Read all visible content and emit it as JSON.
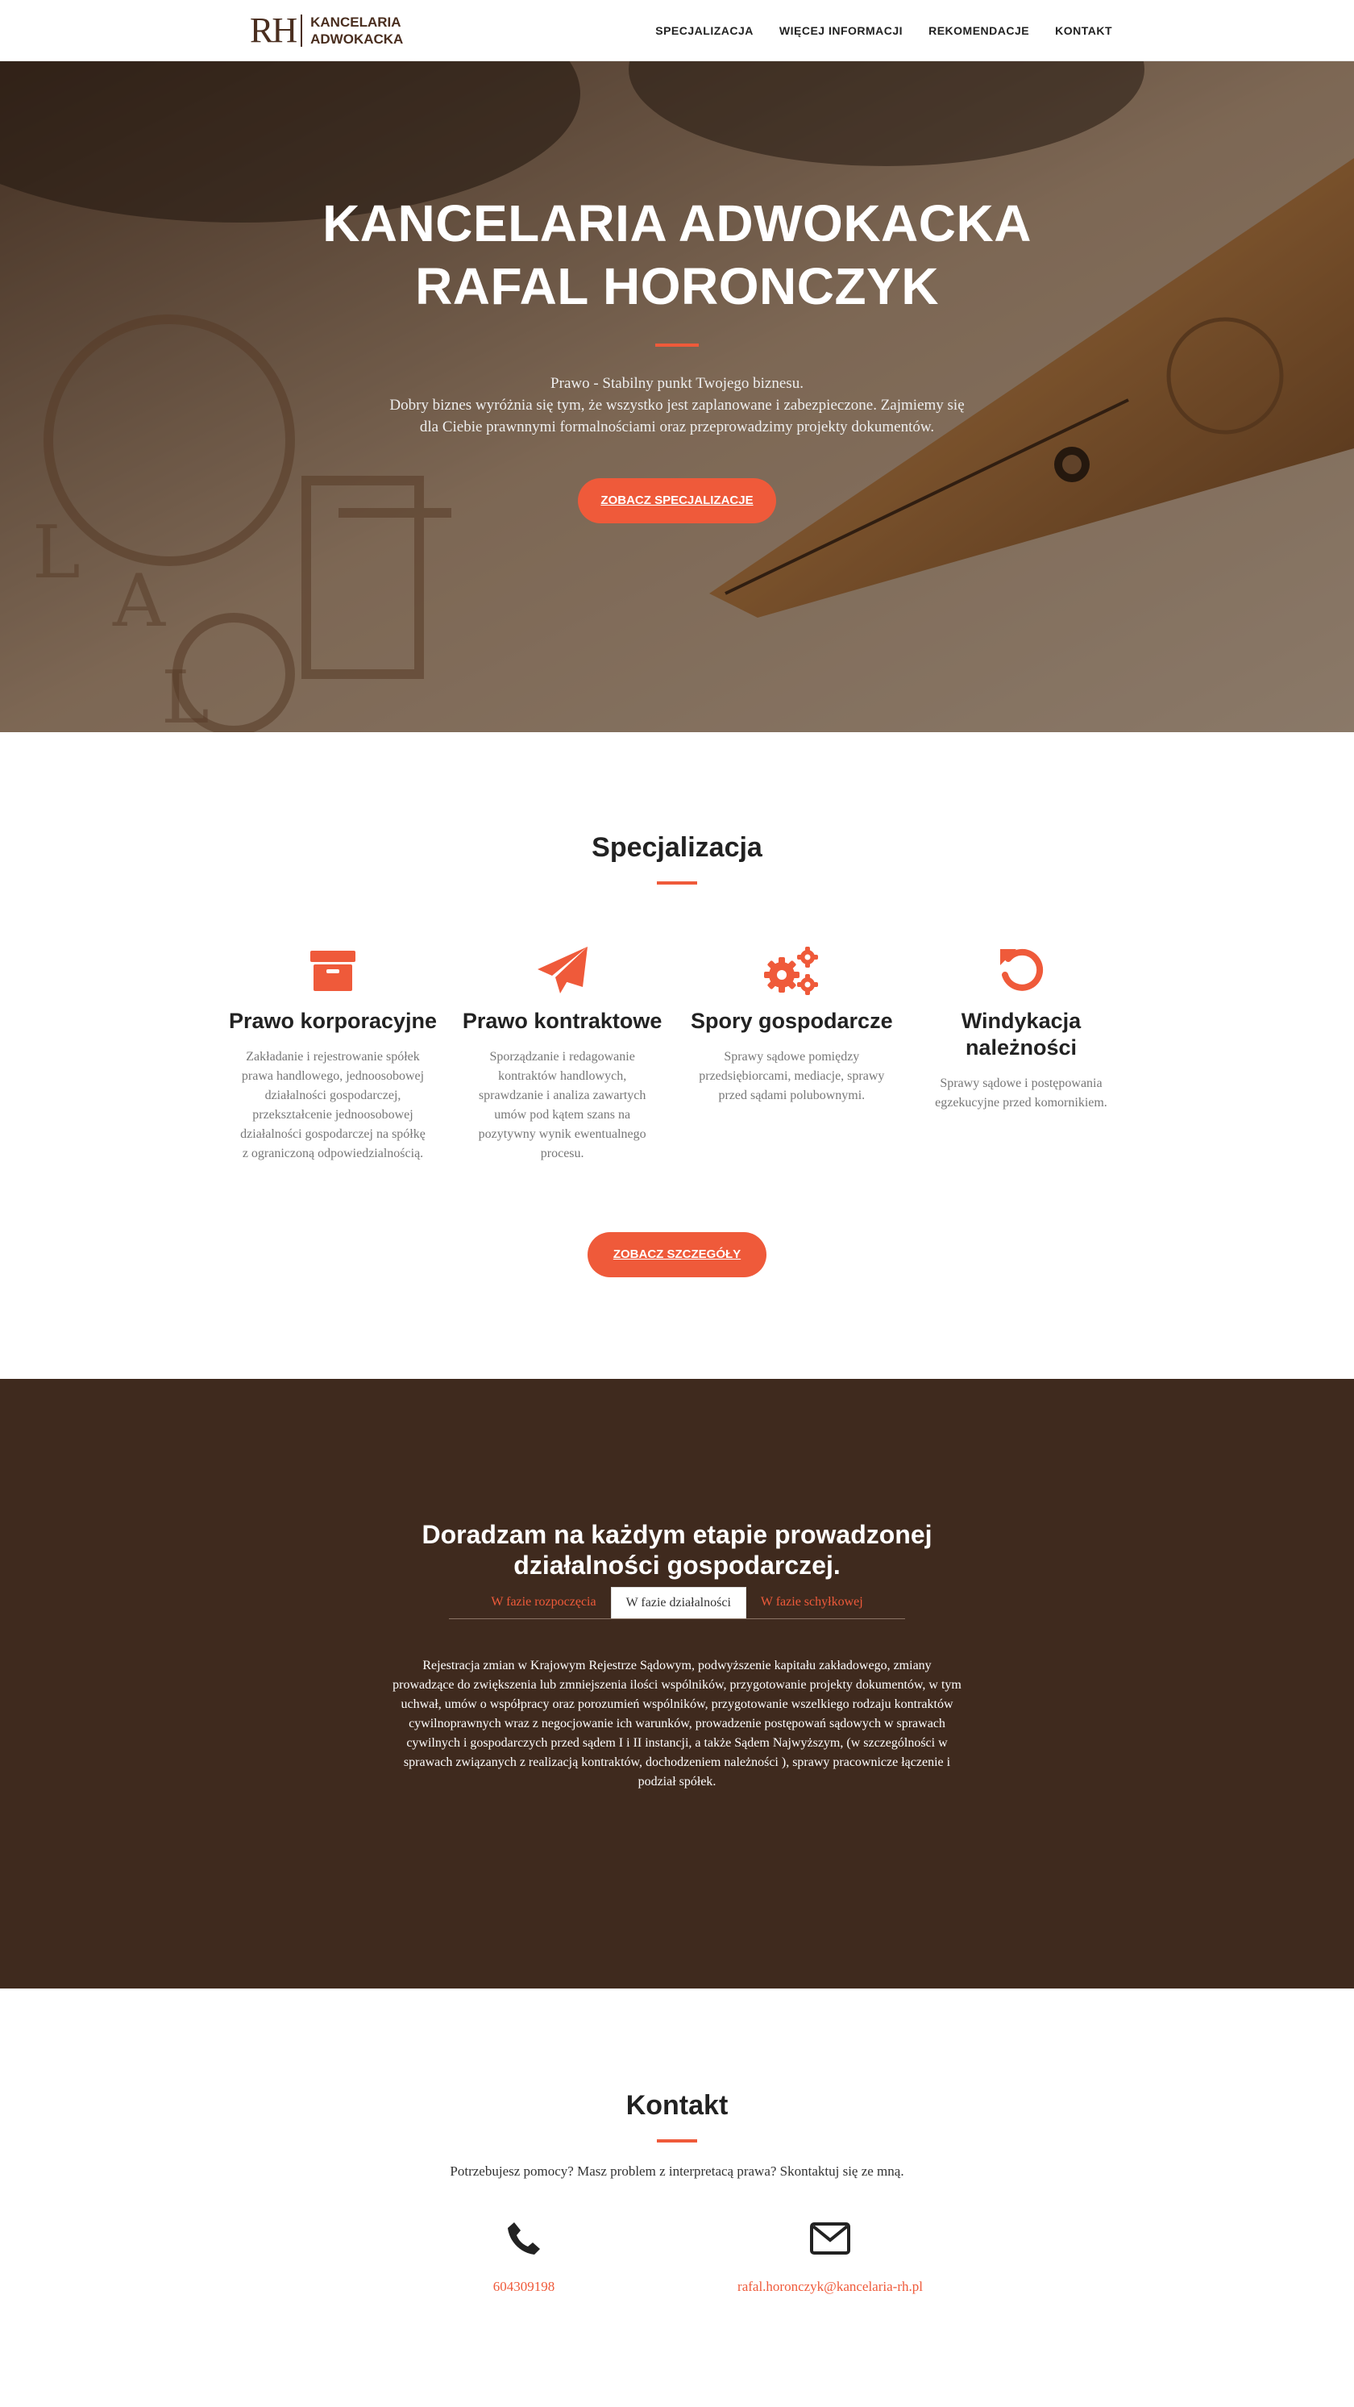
{
  "nav": {
    "logo_mark": "RH",
    "logo_line1": "KANCELARIA",
    "logo_line2": "ADWOKACKA",
    "items": [
      "SPECJALIZACJA",
      "WIĘCEJ INFORMACJI",
      "REKOMENDACJE",
      "KONTAKT"
    ]
  },
  "hero": {
    "title_line1": "KANCELARIA ADWOKACKA",
    "title_line2": "RAFAL HORONCZYK",
    "text_line1": "Prawo - Stabilny punkt Twojego biznesu.",
    "text_line2": "Dobry biznes wyróżnia się tym, że wszystko jest zaplanowane i zabezpieczone. Zajmiemy się dla Ciebie prawnnymi formalnościami oraz przeprowadzimy projekty dokumentów.",
    "button": "ZOBACZ SPECJALIZACJE"
  },
  "specjalizacja": {
    "title": "Specjalizacja",
    "items": [
      {
        "icon": "archive-box-icon",
        "heading": "Prawo korporacyjne",
        "desc": "Zakładanie i rejestrowanie spółek prawa handlowego, jednoosobowej działalności gospodarczej, przekształcenie jednoosobowej działalności gospodarczej na spółkę z ograniczoną odpowiedzialnością."
      },
      {
        "icon": "paper-plane-icon",
        "heading": "Prawo kontraktowe",
        "desc": "Sporządzanie i redagowanie kontraktów handlowych, sprawdzanie i analiza zawartych umów pod kątem szans na pozytywny wynik ewentualnego procesu."
      },
      {
        "icon": "gears-icon",
        "heading": "Spory gospodarcze",
        "desc": "Sprawy sądowe pomiędzy przedsiębiorcami, mediacje, sprawy przed sądami polubownymi."
      },
      {
        "icon": "undo-arrow-icon",
        "heading": "Windykacja należności",
        "desc": "Sprawy sądowe i postępowania egzekucyjne przed komornikiem."
      }
    ],
    "button": "ZOBACZ SZCZEGÓŁY"
  },
  "doradztwo": {
    "title": "Doradzam na każdym etapie prowadzonej działalności gospodarczej.",
    "tabs": [
      "W fazie rozpoczęcia",
      "W fazie działalności",
      "W fazie schyłkowej"
    ],
    "active_tab": "W fazie działalności",
    "text": "Rejestracja zmian w Krajowym Rejestrze Sądowym, podwyższenie kapitału zakładowego, zmiany prowadzące do zwiększenia lub zmniejszenia ilości wspólników, przygotowanie projekty dokumentów, w tym uchwał, umów o współpracy oraz porozumień wspólników, przygotowanie wszelkiego rodzaju kontraktów cywilnoprawnych wraz z negocjowanie ich warunków, prowadzenie postępowań sądowych w sprawach cywilnych i gospodarczych przed sądem I i II instancji, a także Sądem Najwyższym, (w szczególności w sprawach związanych z realizacją kontraktów, dochodzeniem należności ), sprawy pracownicze łączenie i podział spółek."
  },
  "kontakt": {
    "title": "Kontakt",
    "lead": "Potrzebujesz pomocy? Masz problem z interpretacą prawa? Skontaktuj się ze mną.",
    "phone": "604309198",
    "email": "rafal.horonczyk@kancelaria-rh.pl"
  },
  "colors": {
    "accent": "#ef5a3a",
    "dark_brown": "#3f2a1e",
    "logo": "#4a2e1f"
  }
}
